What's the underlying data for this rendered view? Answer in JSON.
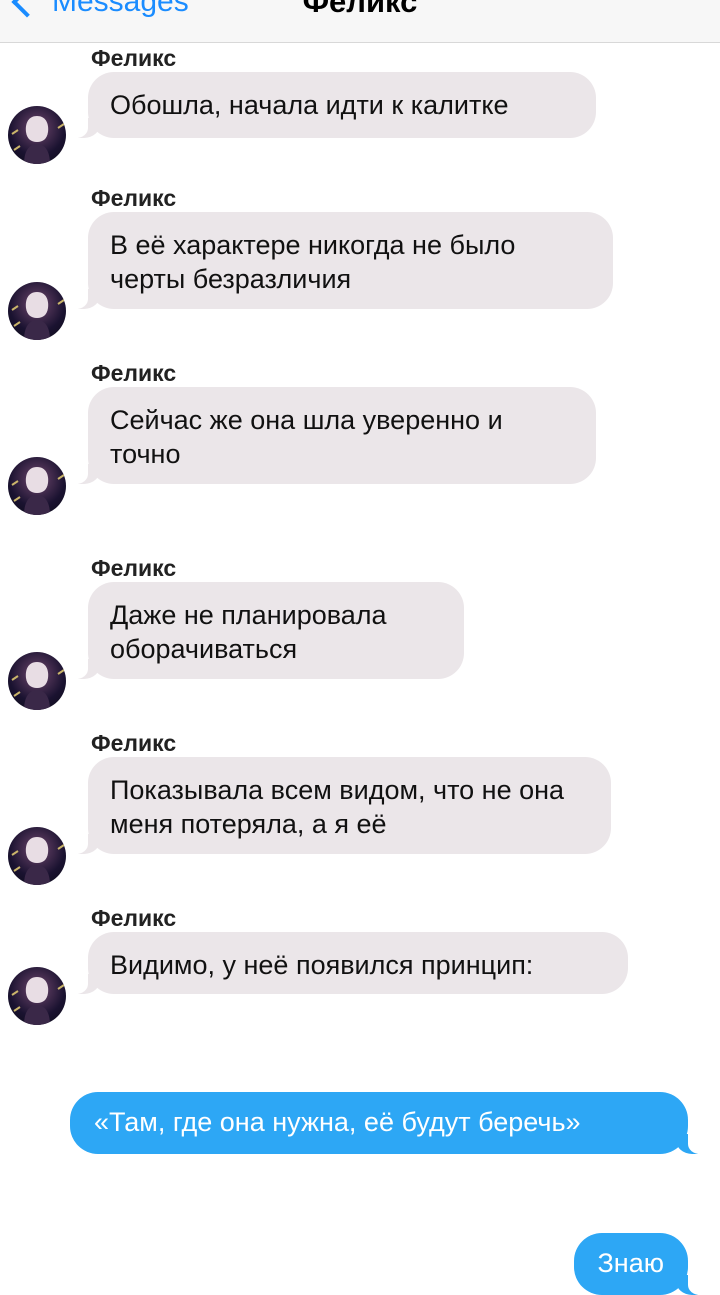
{
  "header": {
    "back_label": "Messages",
    "title": "Феликс"
  },
  "messages": [
    {
      "sender": "Феликс",
      "text": "Обошла, начала идти к калитке"
    },
    {
      "sender": "Феликс",
      "text": "В её характере никогда не было черты безразличия"
    },
    {
      "sender": "Феликс",
      "text": "Сейчас же она шла уверенно и точно"
    },
    {
      "sender": "Феликс",
      "text": "Даже не планировала оборачиваться"
    },
    {
      "sender": "Феликс",
      "text": "Показывала всем видом, что не она меня потеряла, а я её"
    },
    {
      "sender": "Феликс",
      "text": "Видимо, у неё появился принцип:"
    }
  ],
  "outgoing": [
    {
      "text": "«Там, где она нужна, её будут беречь»"
    },
    {
      "text": "Знаю"
    }
  ],
  "colors": {
    "incoming_bubble": "#ebe6e9",
    "outgoing_bubble": "#2da7f5",
    "accent": "#1a8cff"
  },
  "icons": {
    "back": "chevron-left-icon",
    "avatar": "contact-avatar"
  }
}
